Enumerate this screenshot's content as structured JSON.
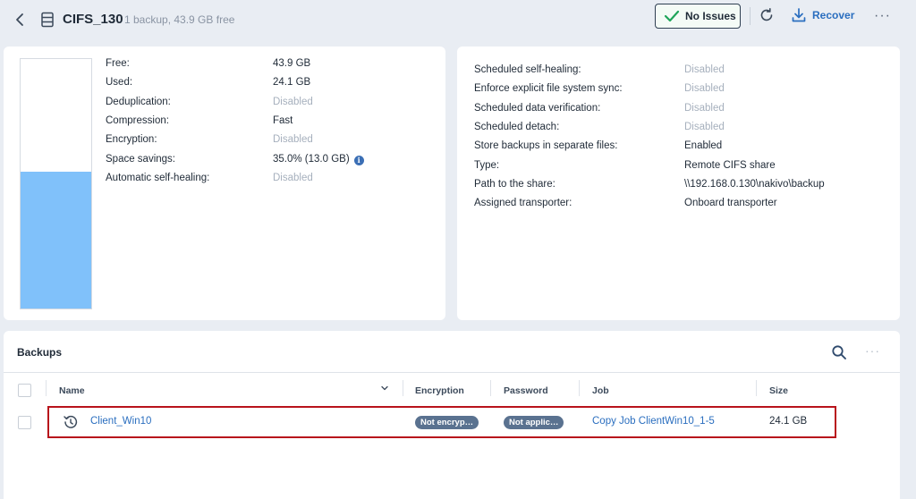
{
  "header": {
    "title": "CIFS_130",
    "subtitle": "1 backup, 43.9 GB free",
    "status_label": "No Issues",
    "recover_label": "Recover",
    "more_label": "···"
  },
  "storage": {
    "used_fraction": 0.55,
    "props": [
      {
        "key": "Free:",
        "value": "43.9 GB",
        "disabled": false
      },
      {
        "key": "Used:",
        "value": "24.1 GB",
        "disabled": false
      },
      {
        "key": "Deduplication:",
        "value": "Disabled",
        "disabled": true
      },
      {
        "key": "Compression:",
        "value": "Fast",
        "disabled": false
      },
      {
        "key": "Encryption:",
        "value": "Disabled",
        "disabled": true
      },
      {
        "key": "Space savings:",
        "value": "35.0% (13.0 GB)",
        "disabled": false
      },
      {
        "key": "Automatic self-healing:",
        "value": "Disabled",
        "disabled": true
      }
    ]
  },
  "settings": {
    "props": [
      {
        "key": "Scheduled self-healing:",
        "value": "Disabled",
        "disabled": true
      },
      {
        "key": "Enforce explicit file system sync:",
        "value": "Disabled",
        "disabled": true
      },
      {
        "key": "Scheduled data verification:",
        "value": "Disabled",
        "disabled": true
      },
      {
        "key": "Scheduled detach:",
        "value": "Disabled",
        "disabled": true
      },
      {
        "key": "Store backups in separate files:",
        "value": "Enabled",
        "disabled": false
      },
      {
        "key": "Type:",
        "value": "Remote CIFS share",
        "disabled": false
      },
      {
        "key": "Path to the share:",
        "value": "\\\\192.168.0.130\\nakivo\\backup",
        "disabled": false
      },
      {
        "key": "Assigned transporter:",
        "value": "Onboard transporter",
        "disabled": false
      }
    ]
  },
  "backups": {
    "title": "Backups",
    "more_label": "···",
    "columns": [
      "Name",
      "Encryption",
      "Password",
      "Job",
      "Size"
    ],
    "rows": [
      {
        "name": "Client_Win10",
        "encryption": "Not encryp…",
        "password": "Not applic…",
        "job": "Copy Job ClientWin10_1-5",
        "size": "24.1 GB"
      }
    ]
  },
  "colors": {
    "accent": "#2a6ebf",
    "gauge_fill": "#80c1fa",
    "success": "#1fa55a",
    "highlight": "#b8131b",
    "pill": "#5a7290"
  }
}
